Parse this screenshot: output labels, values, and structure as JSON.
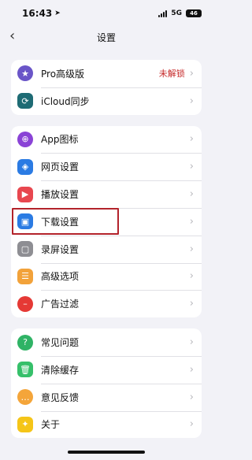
{
  "status": {
    "time": "16:43",
    "network": "5G",
    "battery": "46"
  },
  "header": {
    "title": "设置",
    "back_icon": "chevron-left-icon"
  },
  "groups": [
    {
      "items": [
        {
          "label": "Pro高级版",
          "value": "未解锁",
          "icon": "star-icon",
          "color": "#6a55c8"
        },
        {
          "label": "iCloud同步",
          "icon": "sync-icon",
          "color": "#1e6b74"
        }
      ]
    },
    {
      "items": [
        {
          "label": "App图标",
          "icon": "grid-icon",
          "color": "#8a43d6"
        },
        {
          "label": "网页设置",
          "icon": "compass-icon",
          "color": "#2b7be3"
        },
        {
          "label": "播放设置",
          "icon": "play-icon",
          "color": "#e8474f"
        },
        {
          "label": "下载设置",
          "icon": "download-icon",
          "color": "#2b7be3"
        },
        {
          "label": "录屏设置",
          "icon": "watch-icon",
          "color": "#8e8e93"
        },
        {
          "label": "高级选项",
          "icon": "sliders-icon",
          "color": "#f2a23a"
        },
        {
          "label": "广告过滤",
          "icon": "block-icon",
          "color": "#e53935"
        }
      ]
    },
    {
      "items": [
        {
          "label": "常见问题",
          "icon": "question-icon",
          "color": "#2fb365"
        },
        {
          "label": "清除缓存",
          "icon": "trash-icon",
          "color": "#36c06a"
        },
        {
          "label": "意见反馈",
          "icon": "chat-icon",
          "color": "#f4a53a"
        },
        {
          "label": "关于",
          "icon": "bulb-icon",
          "color": "#f5c518"
        }
      ]
    }
  ],
  "highlighted_item": "下载设置"
}
